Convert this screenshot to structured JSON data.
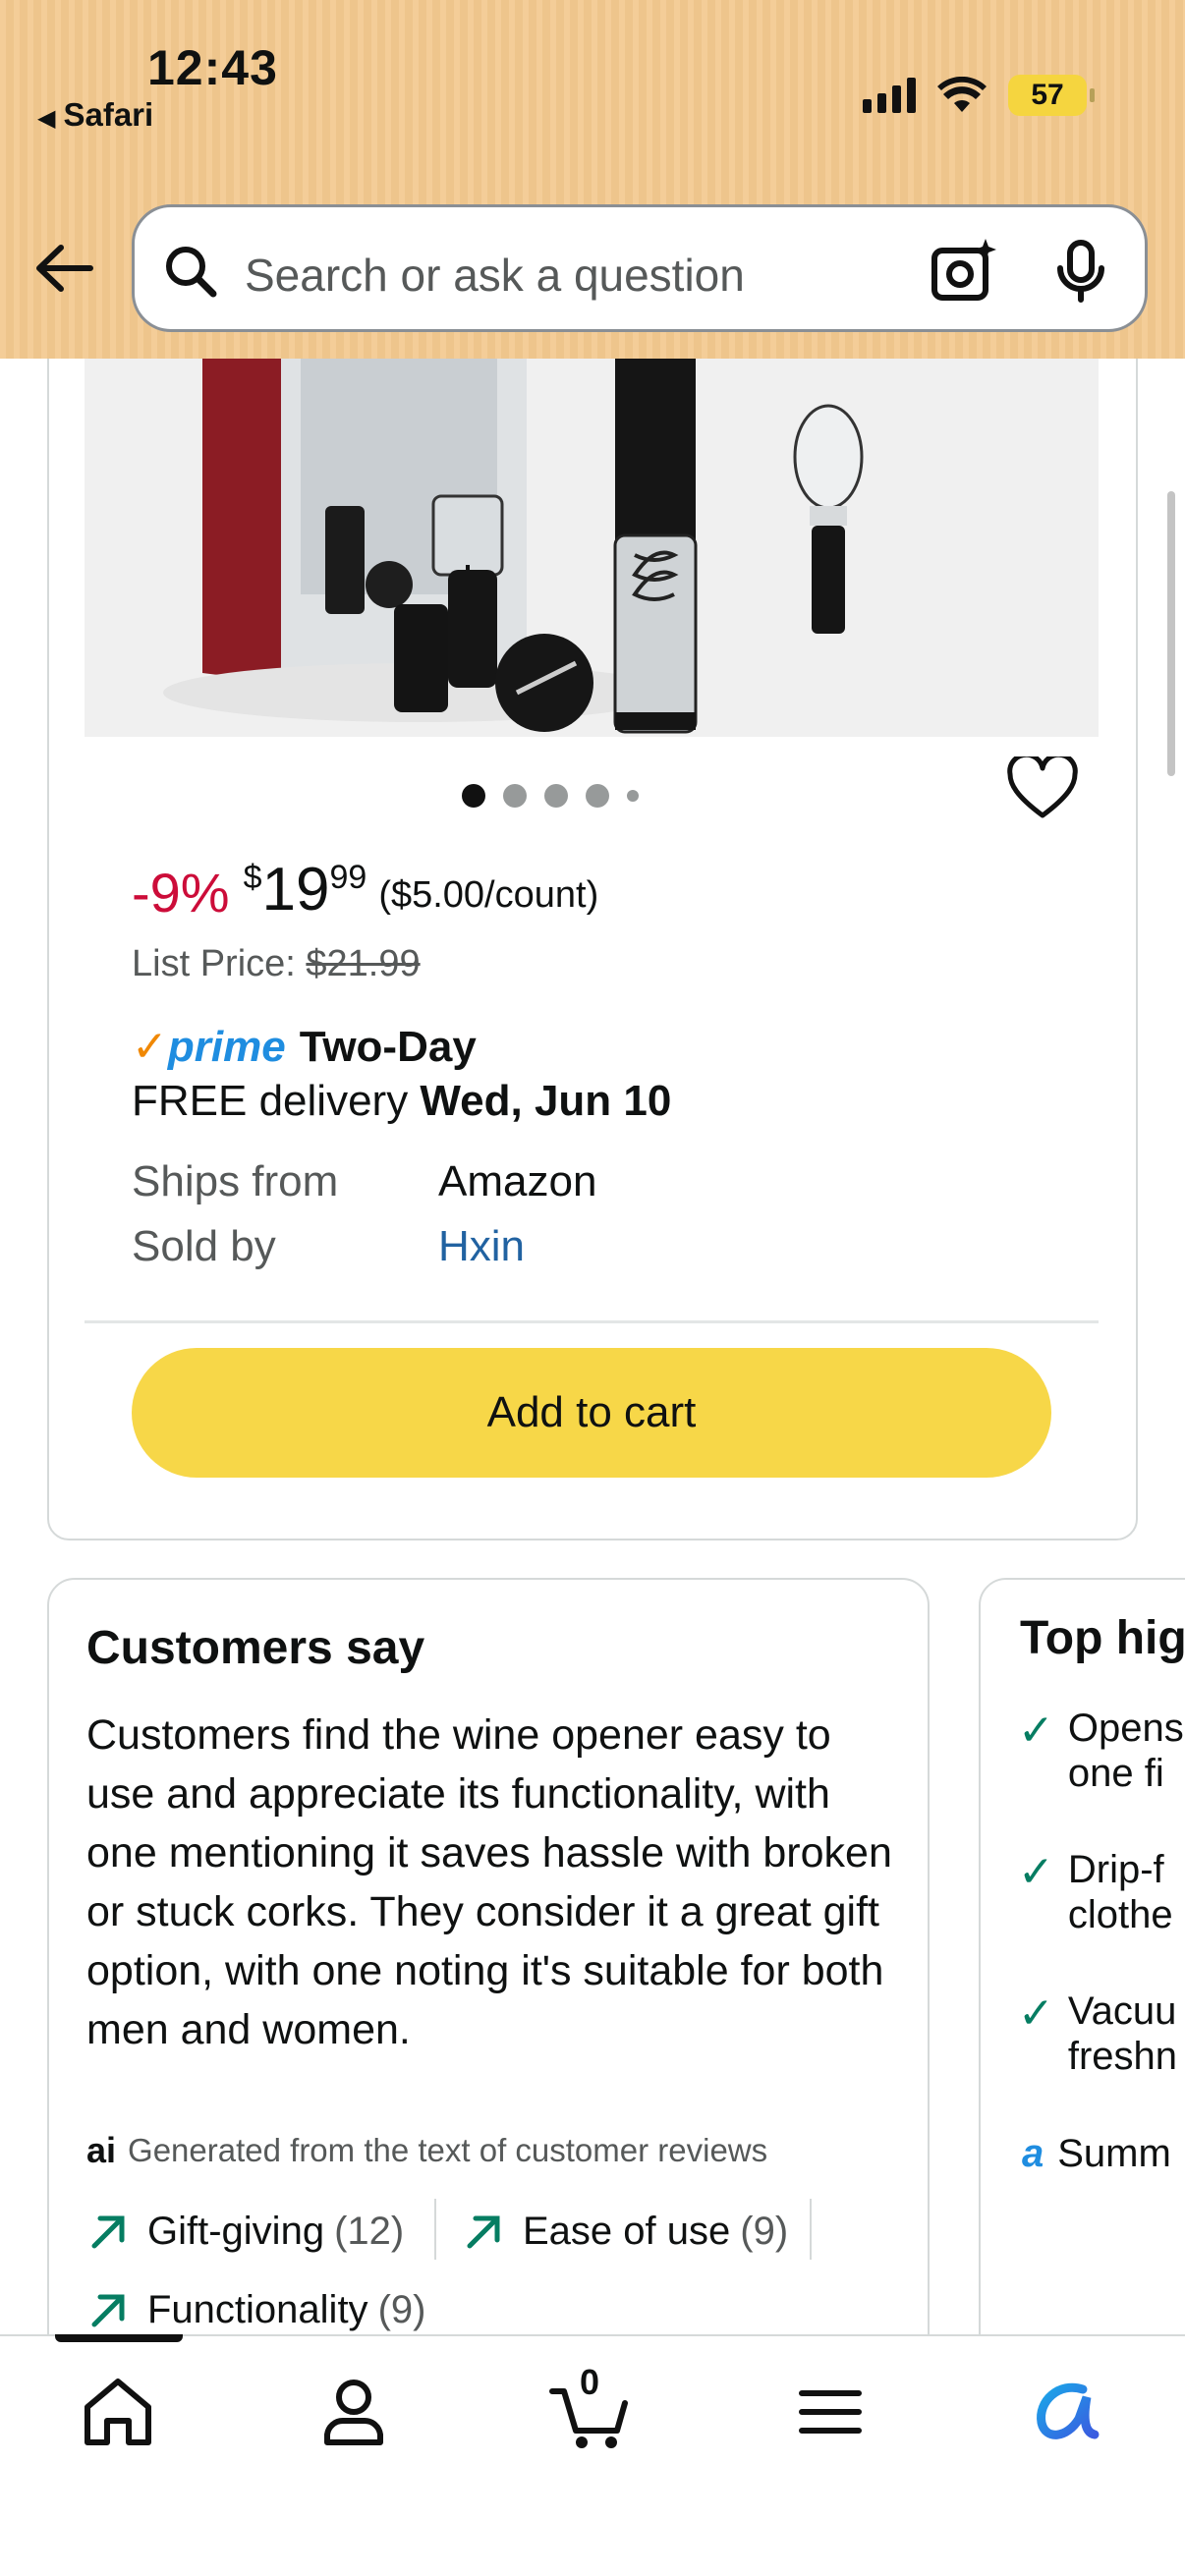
{
  "status_bar": {
    "time": "12:43",
    "back_app": "Safari",
    "battery": "57"
  },
  "search": {
    "placeholder": "Search or ask a question"
  },
  "product": {
    "discount": "-9%",
    "currency": "$",
    "price_whole": "19",
    "price_fraction": "99",
    "per_count": "($5.00/count)",
    "list_price_label": "List Price:",
    "list_price": "$21.99",
    "prime_label": "prime",
    "prime_speed": "Two-Day",
    "delivery_prefix": "FREE delivery",
    "delivery_date": "Wed, Jun 10",
    "ships_from_label": "Ships from",
    "ships_from": "Amazon",
    "sold_by_label": "Sold by",
    "sold_by": "Hxin",
    "add_to_cart": "Add to cart"
  },
  "customers_say": {
    "title": "Customers say",
    "summary": "Customers find the wine opener easy to use and appreciate its functionality, with one mentioning it saves hassle with broken or stuck corks. They consider it a great gift option, with one noting it's suitable for both men and women.",
    "ai_note": "Generated from the text of customer reviews",
    "ai_icon_text": "ai",
    "chips": [
      {
        "label": "Gift-giving",
        "count": "(12)"
      },
      {
        "label": "Ease of use",
        "count": "(9)"
      },
      {
        "label": "Functionality",
        "count": "(9)"
      }
    ]
  },
  "top_highlights": {
    "title": "Top hig",
    "items": [
      {
        "line1": "Opens",
        "line2": "one fi"
      },
      {
        "line1": "Drip-f",
        "line2": "clothe"
      },
      {
        "line1": "Vacuu",
        "line2": "freshn"
      }
    ],
    "summary_link": "Summ"
  },
  "bottom_nav": {
    "cart_count": "0"
  },
  "colors": {
    "header": "#f3c98f",
    "add_to_cart": "#f7d748",
    "discount": "#cc0c39",
    "prime": "#1f8de0",
    "link": "#2162a1"
  }
}
